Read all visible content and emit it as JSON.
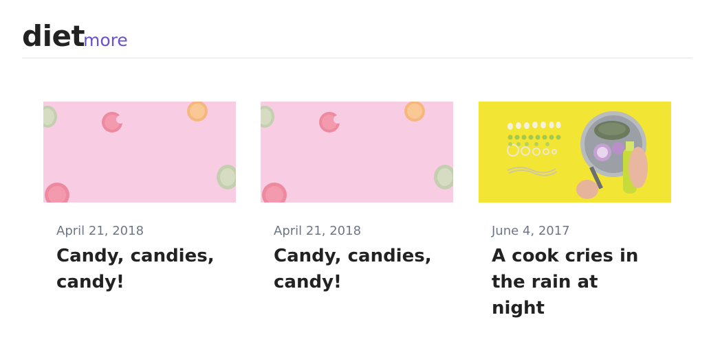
{
  "section": {
    "title": "diet",
    "more_label": "more",
    "accent_color": "#6a4fd3"
  },
  "posts": [
    {
      "date": "April 21, 2018",
      "title": "Candy, candies, candy!",
      "image": "pink-macarons-photo"
    },
    {
      "date": "April 21, 2018",
      "title": "Candy, candies, candy!",
      "image": "pink-macarons-photo"
    },
    {
      "date": "June 4, 2017",
      "title": "A cook cries in the rain at night",
      "image": "yellow-cooking-pan-photo"
    }
  ],
  "colors": {
    "pink_bg": "#f8cde4",
    "yellow_bg": "#f3e534",
    "date_text": "#6b7687",
    "divider": "#e2e2e2"
  }
}
